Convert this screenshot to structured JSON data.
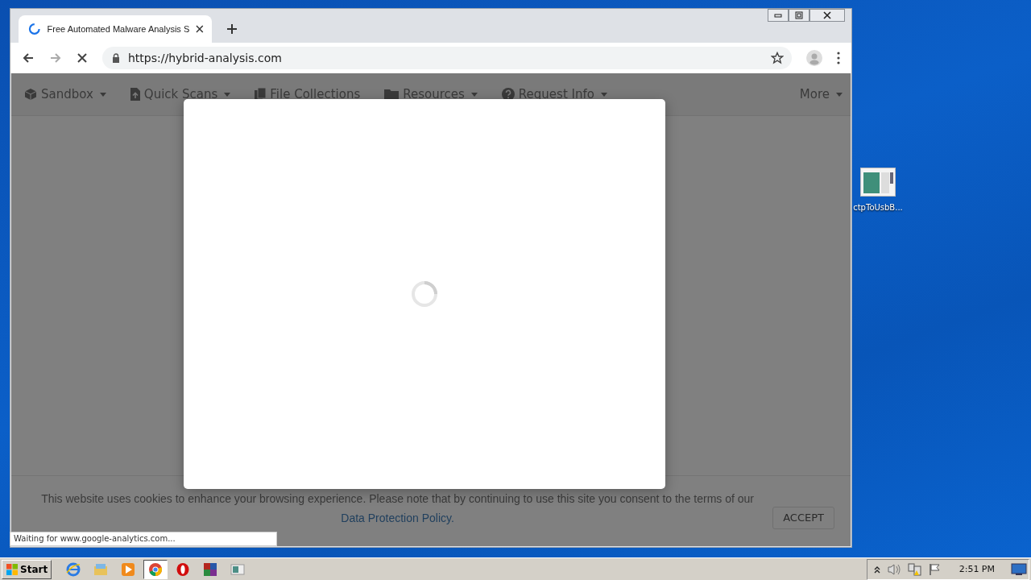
{
  "browser": {
    "tab": {
      "title": "Free Automated Malware Analysis S",
      "loading": true
    },
    "address": "https://hybrid-analysis.com",
    "status": "Waiting for www.google-analytics.com..."
  },
  "site_nav": [
    {
      "label": "Sandbox",
      "kind": "cube",
      "dropdown": true
    },
    {
      "label": "Quick Scans",
      "kind": "upload",
      "dropdown": true
    },
    {
      "label": "File Collections",
      "kind": "files",
      "dropdown": false
    },
    {
      "label": "Resources",
      "kind": "folder",
      "dropdown": true
    },
    {
      "label": "Request Info",
      "kind": "question",
      "dropdown": true
    },
    {
      "label": "More",
      "kind": "plain",
      "dropdown": true
    }
  ],
  "modal": {
    "loading": true
  },
  "cookie_banner": {
    "text": "This website uses cookies to enhance your browsing experience. Please note that by continuing to use this site you consent to the terms of our",
    "link": "Data Protection Policy.",
    "button": "ACCEPT"
  },
  "desktop_icons": [
    {
      "label": "ctpToUsbB..."
    }
  ],
  "taskbar": {
    "start": "Start",
    "apps": [
      {
        "kind": "ie",
        "active": false
      },
      {
        "kind": "explorer",
        "active": false
      },
      {
        "kind": "media",
        "active": false
      },
      {
        "kind": "chrome",
        "active": true
      },
      {
        "kind": "opera",
        "active": false
      },
      {
        "kind": "archive",
        "active": false
      },
      {
        "kind": "window",
        "active": false
      }
    ],
    "clock": "2:51 PM"
  }
}
